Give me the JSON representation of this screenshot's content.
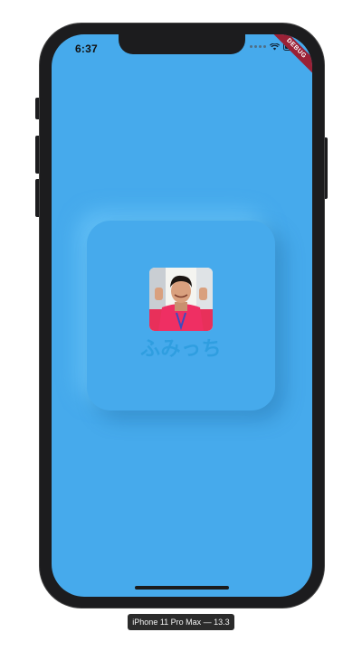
{
  "status_bar": {
    "time": "6:37",
    "debug_banner": "DEBUG"
  },
  "profile_card": {
    "name": "ふみっち",
    "avatar_icon": "profile-photo"
  },
  "device_label": "iPhone 11 Pro Max — 13.3",
  "colors": {
    "screen_background": "#46aaec",
    "name_text": "#2f9ee0",
    "debug_ribbon": "#9a2136"
  }
}
